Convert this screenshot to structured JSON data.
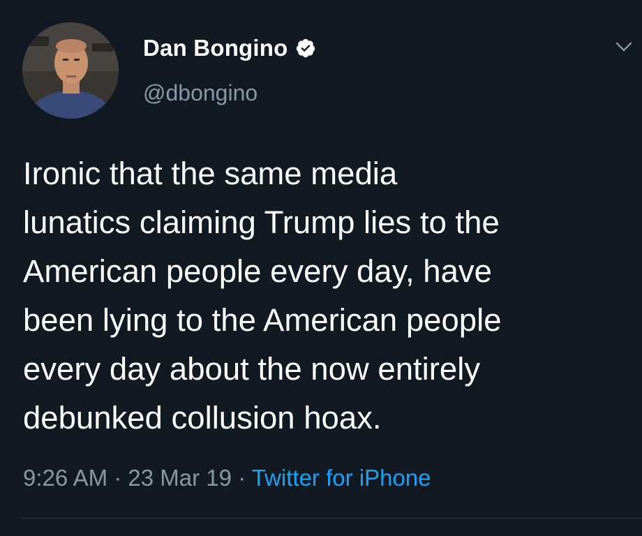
{
  "user": {
    "display_name": "Dan Bongino",
    "handle": "@dbongino"
  },
  "tweet": {
    "text": "Ironic that the same media\nlunatics claiming Trump lies to the\nAmerican people every day, have\nbeen lying to the American people\nevery day about the now entirely\ndebunked collusion hoax.",
    "time": "9:26 AM",
    "separator": " · ",
    "date": "23 Mar 19",
    "source": "Twitter for iPhone"
  },
  "icons": {
    "verified": "verified-badge-icon",
    "menu": "chevron-down-icon"
  },
  "colors": {
    "background": "#111a23",
    "text": "#ffffff",
    "secondary_text": "#8899a6",
    "link": "#1da1f2"
  }
}
